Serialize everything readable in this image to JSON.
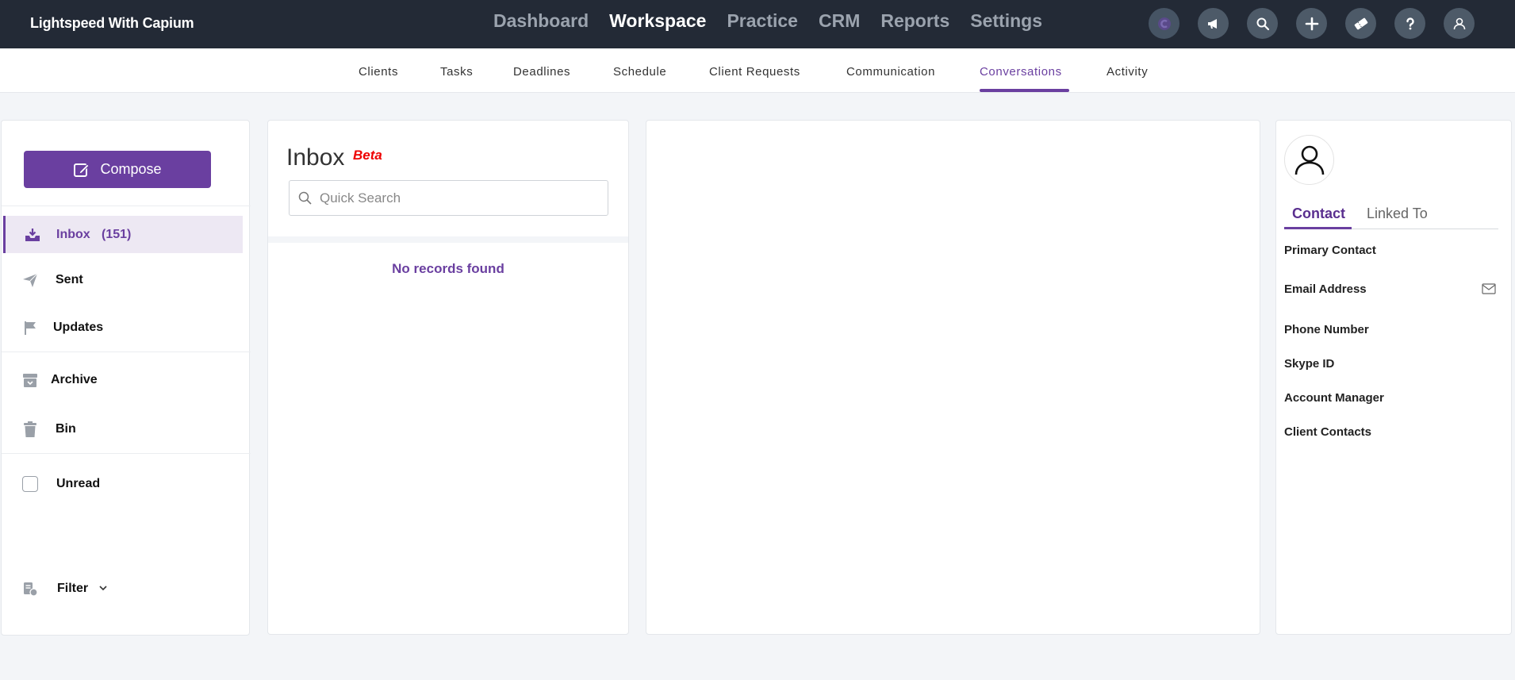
{
  "app": {
    "brand": "Lightspeed With Capium"
  },
  "main_nav": [
    "Dashboard",
    "Workspace",
    "Practice",
    "CRM",
    "Reports",
    "Settings"
  ],
  "main_nav_active": "Workspace",
  "top_icons": [
    "capium-logo-icon",
    "megaphone-icon",
    "search-icon",
    "plus-icon",
    "ticket-icon",
    "help-icon",
    "user-icon"
  ],
  "sub_nav": {
    "items": [
      "Clients",
      "Tasks",
      "Deadlines",
      "Schedule",
      "Client Requests",
      "Communication",
      "Conversations",
      "Activity"
    ],
    "active": "Conversations"
  },
  "sidebar": {
    "compose_label": "Compose",
    "items": [
      {
        "label": "Inbox",
        "count": "(151)",
        "icon": "inbox-icon",
        "active": true
      },
      {
        "label": "Sent",
        "icon": "paper-plane-icon"
      },
      {
        "label": "Updates",
        "icon": "flag-icon"
      },
      {
        "label": "Archive",
        "icon": "archive-icon"
      },
      {
        "label": "Bin",
        "icon": "trash-icon"
      },
      {
        "label": "Unread",
        "icon": "checkbox"
      },
      {
        "label": "Filter",
        "icon": "filter-icon"
      }
    ]
  },
  "inbox": {
    "title": "Inbox",
    "badge": "Beta",
    "search_placeholder": "Quick Search",
    "empty_text": "No records found"
  },
  "contact": {
    "tabs": [
      "Contact",
      "Linked To"
    ],
    "active_tab": "Contact",
    "fields": [
      "Primary Contact",
      "Email Address",
      "Phone Number",
      "Skype ID",
      "Account Manager",
      "Client Contacts"
    ]
  },
  "colors": {
    "accent": "#6a3fa0",
    "topbar": "#232a36",
    "beta": "#e00000"
  }
}
